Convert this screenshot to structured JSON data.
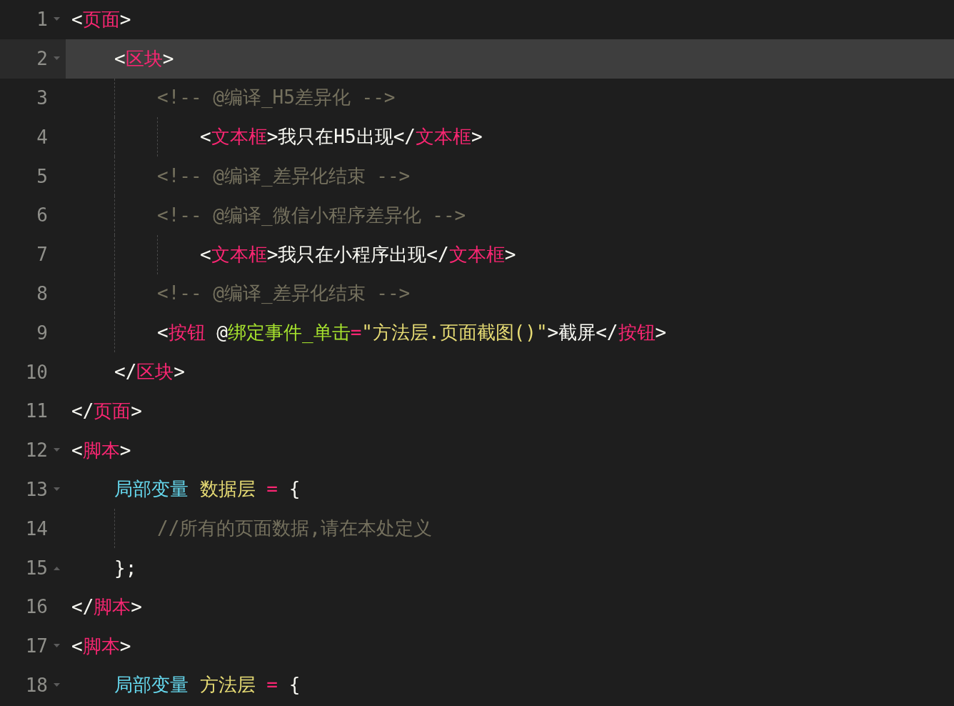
{
  "editor": {
    "lines": [
      {
        "number": "1",
        "expanded": true,
        "selected": false,
        "tokens": [
          {
            "kind": "punct",
            "text": "<"
          },
          {
            "kind": "tag",
            "text": "页面"
          },
          {
            "kind": "punct",
            "text": ">"
          }
        ],
        "children": [
          {
            "number": "2",
            "expanded": true,
            "selected": true,
            "tokens": [
              {
                "kind": "punct",
                "text": "<"
              },
              {
                "kind": "tag",
                "text": "区块"
              },
              {
                "kind": "punct",
                "text": ">"
              }
            ],
            "children": [
              {
                "number": "3",
                "selected": false,
                "tokens": [
                  {
                    "kind": "comment",
                    "text": "<!-- @编译_H5差异化 -->"
                  }
                ],
                "children": [
                  {
                    "number": "4",
                    "selected": false,
                    "tokens": [
                      {
                        "kind": "punct",
                        "text": "<"
                      },
                      {
                        "kind": "tag",
                        "text": "文本框"
                      },
                      {
                        "kind": "punct",
                        "text": ">"
                      },
                      {
                        "kind": "text",
                        "text": "我只在H5出现"
                      },
                      {
                        "kind": "punct",
                        "text": "</"
                      },
                      {
                        "kind": "tag",
                        "text": "文本框"
                      },
                      {
                        "kind": "punct",
                        "text": ">"
                      }
                    ]
                  }
                ]
              },
              {
                "number": "5",
                "selected": false,
                "tokens": [
                  {
                    "kind": "comment",
                    "text": "<!-- @编译_差异化结束 -->"
                  }
                ]
              },
              {
                "number": "6",
                "selected": false,
                "tokens": [
                  {
                    "kind": "comment",
                    "text": "<!-- @编译_微信小程序差异化 -->"
                  }
                ],
                "children": [
                  {
                    "number": "7",
                    "selected": false,
                    "tokens": [
                      {
                        "kind": "punct",
                        "text": "<"
                      },
                      {
                        "kind": "tag",
                        "text": "文本框"
                      },
                      {
                        "kind": "punct",
                        "text": ">"
                      },
                      {
                        "kind": "text",
                        "text": "我只在小程序出现"
                      },
                      {
                        "kind": "punct",
                        "text": "</"
                      },
                      {
                        "kind": "tag",
                        "text": "文本框"
                      },
                      {
                        "kind": "punct",
                        "text": ">"
                      }
                    ]
                  }
                ]
              },
              {
                "number": "8",
                "selected": false,
                "tokens": [
                  {
                    "kind": "comment",
                    "text": "<!-- @编译_差异化结束 -->"
                  }
                ]
              },
              {
                "number": "9",
                "selected": false,
                "tokens": [
                  {
                    "kind": "punct",
                    "text": "<"
                  },
                  {
                    "kind": "tag",
                    "text": "按钮 "
                  },
                  {
                    "kind": "punct",
                    "text": "@"
                  },
                  {
                    "kind": "attr",
                    "text": "绑定事件_单击"
                  },
                  {
                    "kind": "op",
                    "text": "="
                  },
                  {
                    "kind": "string",
                    "text": "\"方法层.页面截图()\""
                  },
                  {
                    "kind": "punct",
                    "text": ">"
                  },
                  {
                    "kind": "text",
                    "text": "截屏"
                  },
                  {
                    "kind": "punct",
                    "text": "</"
                  },
                  {
                    "kind": "tag",
                    "text": "按钮"
                  },
                  {
                    "kind": "punct",
                    "text": ">"
                  }
                ]
              }
            ]
          },
          {
            "number": "10",
            "selected": false,
            "tokens": [
              {
                "kind": "punct",
                "text": "</"
              },
              {
                "kind": "tag",
                "text": "区块"
              },
              {
                "kind": "punct",
                "text": ">"
              }
            ]
          }
        ]
      },
      {
        "number": "11",
        "selected": false,
        "tokens": [
          {
            "kind": "punct",
            "text": "</"
          },
          {
            "kind": "tag",
            "text": "页面"
          },
          {
            "kind": "punct",
            "text": ">"
          }
        ]
      },
      {
        "number": "12",
        "expanded": true,
        "selected": false,
        "tokens": [
          {
            "kind": "punct",
            "text": "<"
          },
          {
            "kind": "tag",
            "text": "脚本"
          },
          {
            "kind": "punct",
            "text": ">"
          }
        ],
        "children": [
          {
            "number": "13",
            "expanded": true,
            "selected": false,
            "tokens": [
              {
                "kind": "keyword",
                "text": "局部变量 "
              },
              {
                "kind": "name",
                "text": "数据层 "
              },
              {
                "kind": "op",
                "text": "= "
              },
              {
                "kind": "punct",
                "text": "{"
              }
            ],
            "children": [
              {
                "number": "14",
                "selected": false,
                "tokens": [
                  {
                    "kind": "comment",
                    "text": "//所有的页面数据,请在本处定义"
                  }
                ]
              }
            ]
          },
          {
            "number": "15",
            "fold_end": true,
            "selected": false,
            "tokens": [
              {
                "kind": "punct",
                "text": "};"
              }
            ]
          }
        ]
      },
      {
        "number": "16",
        "selected": false,
        "tokens": [
          {
            "kind": "punct",
            "text": "</"
          },
          {
            "kind": "tag",
            "text": "脚本"
          },
          {
            "kind": "punct",
            "text": ">"
          }
        ]
      },
      {
        "number": "17",
        "expanded": true,
        "selected": false,
        "tokens": [
          {
            "kind": "punct",
            "text": "<"
          },
          {
            "kind": "tag",
            "text": "脚本"
          },
          {
            "kind": "punct",
            "text": ">"
          }
        ],
        "children": [
          {
            "number": "18",
            "expanded": true,
            "selected": false,
            "tokens": [
              {
                "kind": "keyword",
                "text": "局部变量 "
              },
              {
                "kind": "name",
                "text": "方法层 "
              },
              {
                "kind": "op",
                "text": "= "
              },
              {
                "kind": "punct",
                "text": "{"
              }
            ]
          }
        ]
      }
    ]
  }
}
